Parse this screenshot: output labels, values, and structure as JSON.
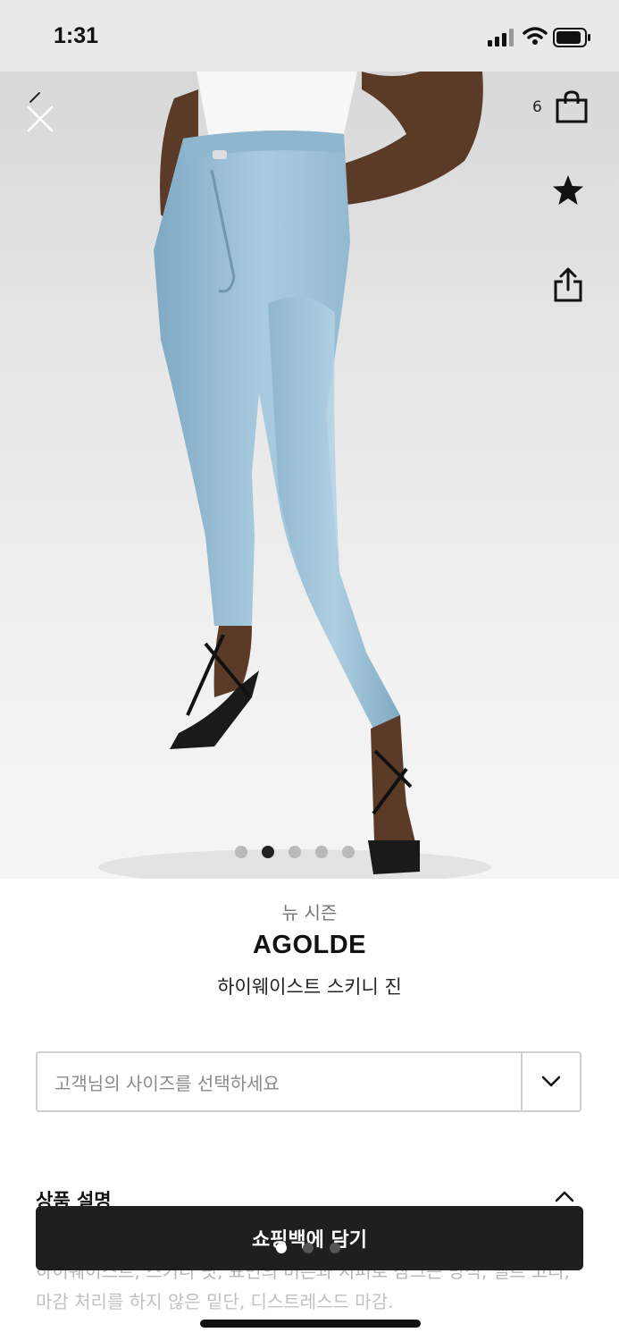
{
  "status_bar": {
    "time": "1:31"
  },
  "header": {
    "bag_count": "6",
    "icons": [
      "close-icon",
      "shopping-bag-icon",
      "star-icon",
      "share-icon"
    ]
  },
  "gallery": {
    "total_images": 5,
    "active_index": 1
  },
  "product": {
    "season": "뉴 시즌",
    "brand": "AGOLDE",
    "name": "하이웨이스트 스키니 진"
  },
  "size_selector": {
    "placeholder": "고객님의 사이즈를 선택하세요"
  },
  "description": {
    "header": "상품 설명",
    "text": "하이웨이스트, 스키니 핏, 표면의 버튼과 지퍼로 잠그는 방식, 벨트 고리, 마감 처리를 하지 않은 밑단, 디스트레스드 마감."
  },
  "cart_button": {
    "label": "쇼핑백에 담기"
  },
  "colors": {
    "button_bg": "#1f1f1f",
    "status_bar_bg": "#e9e9ea",
    "denim": "#9ec3d8"
  }
}
